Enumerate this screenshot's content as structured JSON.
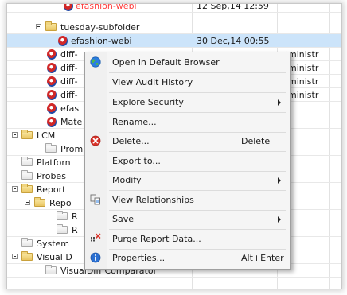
{
  "tree": {
    "partial_row": {
      "name": "efashion-webi",
      "date": "12 Sep,14 12:59"
    },
    "tuesday_folder": "tuesday-subfolder",
    "selected_row": {
      "name": "efashion-webi",
      "date": "30 Dec,14 00:55"
    },
    "diff_rows": [
      "diff-",
      "diff-",
      "diff-",
      "diff-"
    ],
    "owner_col": "dministr",
    "efas_row": "efas",
    "mate_row": "Mate",
    "lcm_folder": "LCM",
    "prom_item": "Prom",
    "platform_item": "Platforn",
    "probes_item": "Probes",
    "report_folder": "Report",
    "repo_item": "Repo",
    "r_item": "R",
    "system_item": "System",
    "visual_folder": "Visual D",
    "visualdiff_item": "VisualDiff Comparator"
  },
  "context_menu": {
    "open_default_browser": "Open in Default Browser",
    "view_audit_history": "View Audit History",
    "explore_security": "Explore Security",
    "rename": "Rename...",
    "delete": "Delete...",
    "delete_shortcut": "Delete",
    "export_to": "Export to...",
    "modify": "Modify",
    "view_relationships": "View Relationships",
    "save": "Save",
    "purge_report_data": "Purge Report Data...",
    "properties": "Properties...",
    "properties_shortcut": "Alt+Enter"
  }
}
